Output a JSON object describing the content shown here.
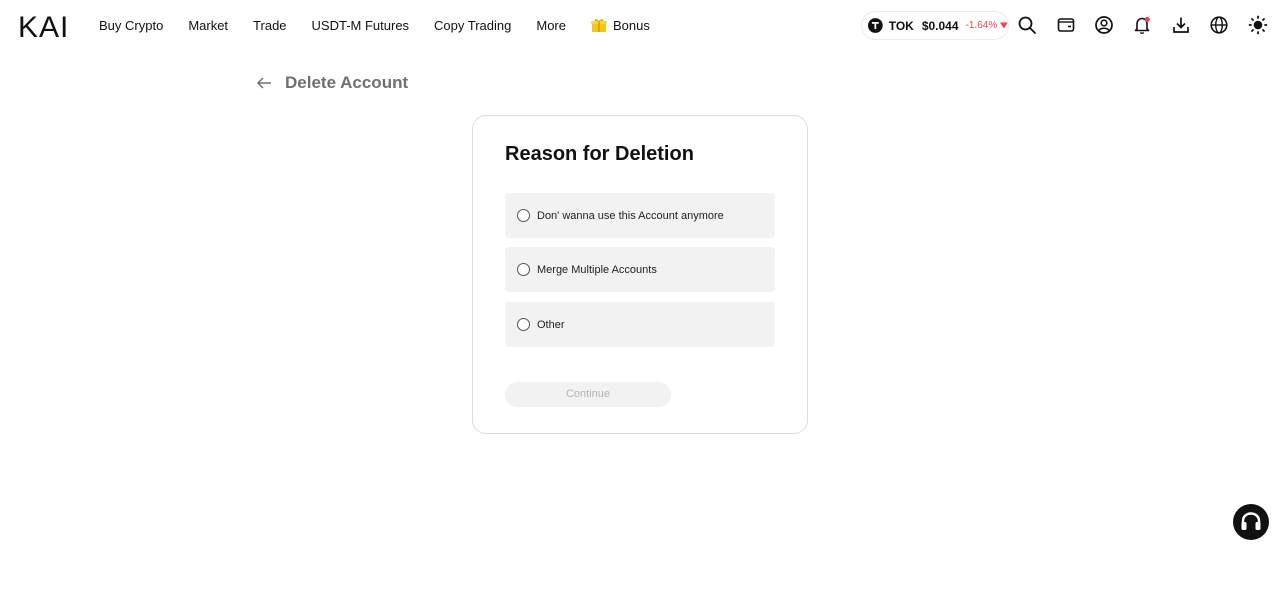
{
  "header": {
    "logo_text": "KAI",
    "nav": [
      {
        "label": "Buy Crypto"
      },
      {
        "label": "Market"
      },
      {
        "label": "Trade"
      },
      {
        "label": "USDT-M Futures"
      },
      {
        "label": "Copy Trading"
      },
      {
        "label": "More"
      }
    ],
    "bonus_label": "Bonus",
    "bonus_icon": "gift-icon",
    "ticker": {
      "symbol": "TOK",
      "price": "$0.044",
      "change": "-1.64%",
      "change_color": "#e5484d"
    },
    "icons": [
      "search-icon",
      "wallet-icon",
      "user-icon",
      "bell-icon",
      "download-icon",
      "globe-icon",
      "sun-icon"
    ]
  },
  "page": {
    "title": "Delete Account"
  },
  "card": {
    "title": "Reason for Deletion",
    "options": [
      {
        "label": "Don' wanna use this Account anymore",
        "selected": false
      },
      {
        "label": "Merge Multiple Accounts",
        "selected": false
      },
      {
        "label": "Other",
        "selected": false
      }
    ],
    "continue_label": "Continue"
  },
  "support": {
    "icon": "headset-icon"
  }
}
